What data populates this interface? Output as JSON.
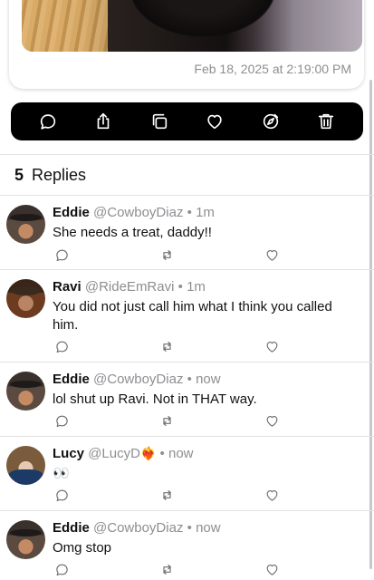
{
  "post": {
    "timestamp": "Feb 18, 2025 at 2:19:00 PM"
  },
  "action_bar": {
    "icons": [
      "comment-icon",
      "share-icon",
      "copy-icon",
      "heart-icon",
      "compass-icon",
      "trash-icon"
    ]
  },
  "replies_header": {
    "count": "5",
    "label": "Replies"
  },
  "replies": [
    {
      "name": "Eddie",
      "handle": "@CowboyDiaz",
      "dot": "•",
      "time": "1m",
      "text": "She needs a treat, daddy!!"
    },
    {
      "name": "Ravi",
      "handle": "@RideEmRavi",
      "dot": "•",
      "time": "1m",
      "text": "You did not just call him what I think you called him."
    },
    {
      "name": "Eddie",
      "handle": "@CowboyDiaz",
      "dot": "•",
      "time": "now",
      "text": "lol shut up Ravi. Not in THAT way."
    },
    {
      "name": "Lucy",
      "handle": "@LucyD",
      "emoji": "❤️‍🔥",
      "dot": "•",
      "time": "now",
      "text": "👀"
    },
    {
      "name": "Eddie",
      "handle": "@CowboyDiaz",
      "dot": "•",
      "time": "now",
      "text": "Omg stop"
    }
  ]
}
